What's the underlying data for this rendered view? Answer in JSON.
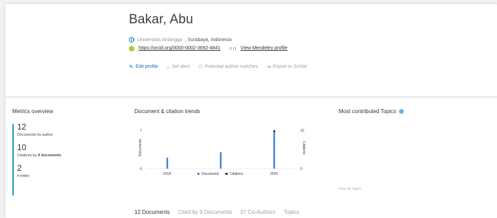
{
  "author": {
    "name": "Bakar, Abu",
    "affiliation_uni": "Universitas Airlangga",
    "affiliation_loc": ", Surabaya, Indonesia",
    "orcid_url": "https://orcid.org/0000-0002-3692-4841",
    "mendeley_label": "View Mendeley profile"
  },
  "actions": {
    "edit": "Edit profile",
    "alert": "Set alert",
    "matches": "Potential author matches",
    "export": "Export to SciVal"
  },
  "metrics": {
    "title": "Metrics overview",
    "documents_value": "12",
    "documents_label": "Documents by author",
    "citations_value": "10",
    "citations_label_pre": "Citations by ",
    "citations_label_bold": "9 documents",
    "hindex_value": "2",
    "hindex_label": "h-index"
  },
  "trends": {
    "title": "Document & citation trends"
  },
  "topics": {
    "title": "Most contributed Topics",
    "view_all": "View all Topics"
  },
  "tabs": [
    "12 Documents",
    "Cited by 9 Documents",
    "37 Co-Authors",
    "Topics"
  ],
  "colors": {
    "documents": "#3d7fd9",
    "citations": "#1f2d6b",
    "accent": "#2b8fc7",
    "orcid": "#a6ce39"
  },
  "chart_data": {
    "type": "bar",
    "title": "Document & citation trends",
    "x_ticks": [
      "2018",
      "2020"
    ],
    "categories": [
      "2018",
      "2019",
      "2020"
    ],
    "series": [
      {
        "name": "Documents",
        "values": [
          2,
          3,
          7
        ]
      },
      {
        "name": "Citations",
        "values": [
          0,
          0,
          10
        ]
      }
    ],
    "ylabel_left": "Documents",
    "ylabel_right": "Citations",
    "ylim_left": [
      0,
      7
    ],
    "ylim_right": [
      0,
      10
    ],
    "y_ticks_left": [
      "0",
      "7"
    ],
    "y_ticks_right": [
      "0",
      "10"
    ],
    "legend": [
      "Documents",
      "Citations"
    ],
    "legend_position": "bottom"
  }
}
